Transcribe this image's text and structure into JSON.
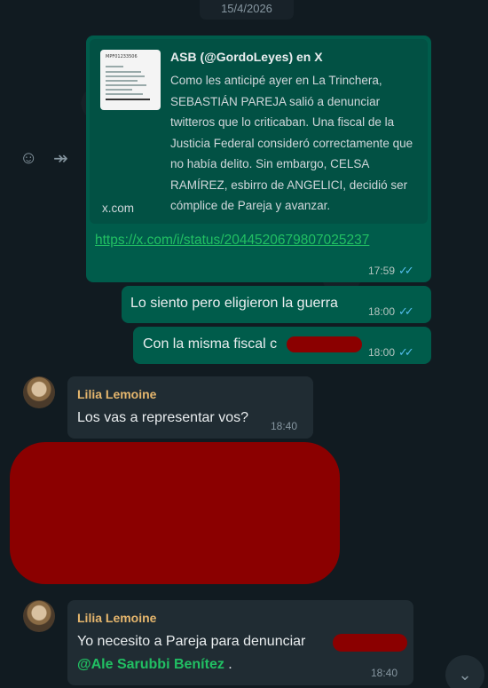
{
  "date_chip": "15/4/2026",
  "preview_msg": {
    "thumb_title": "MPF01233506",
    "title": "ASB (@GordoLeyes) en X",
    "description": "Como les anticipé ayer en La Trinchera, SEBASTIÁN PAREJA salió a denunciar twitteros que lo criticaban. Una fiscal de la Justicia Federal consideró correctamente que no había delito. Sin embargo, CELSA RAMÍREZ, esbirro de ANGELICI, decidió ser cómplice de Pareja y avanzar.",
    "domain": "x.com",
    "link": "https://x.com/i/status/2044520679807025237",
    "time": "17:59"
  },
  "out_msgs": [
    {
      "text": "Lo siento pero eligieron la guerra",
      "time": "18:00"
    },
    {
      "text": "Con la misma fiscal c",
      "time": "18:00"
    }
  ],
  "in_msg_1": {
    "sender": "Lilia Lemoine",
    "text": "Los vas a representar vos?",
    "time": "18:40"
  },
  "in_msg_2": {
    "sender": "Lilia Lemoine",
    "text": "Yo necesito a Pareja para denunciar",
    "mention": "@Ale Sarubbi Benítez",
    "suffix": " .",
    "time": "18:40"
  },
  "icons": {
    "emoji": "emoji-icon",
    "forward": "forward-icon",
    "scroll_down": "chevron-down-icon"
  },
  "colors": {
    "outgoing": "#005c4b",
    "incoming": "#202c33",
    "redaction": "#8b0000",
    "sender": "#e5b66d",
    "link": "#21c063"
  }
}
